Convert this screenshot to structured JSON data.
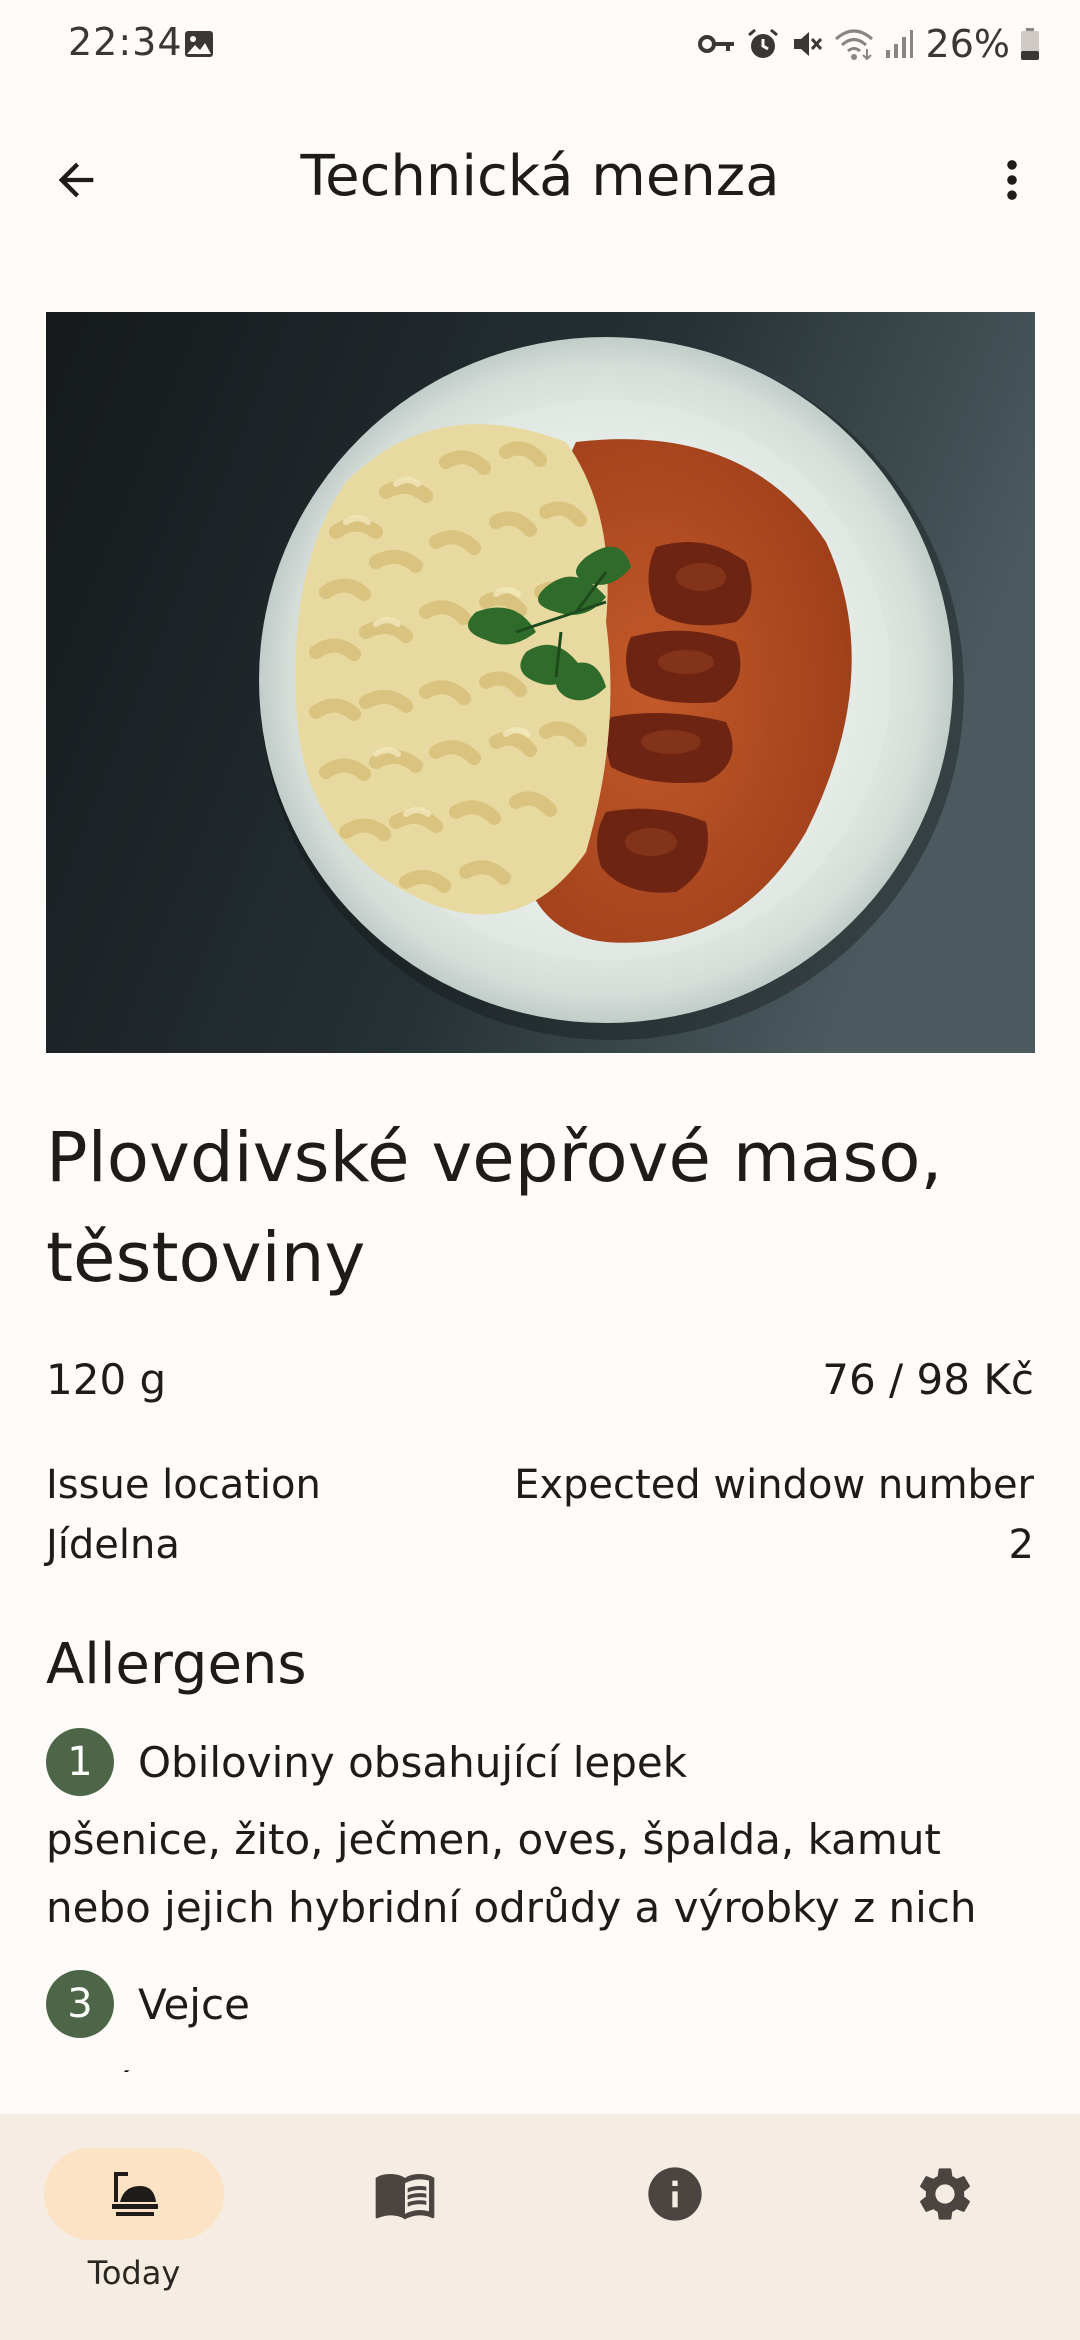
{
  "status_bar": {
    "time": "22:34",
    "battery": "26%",
    "icons": [
      "gallery-icon",
      "key-icon",
      "alarm-icon",
      "mute-icon",
      "wifi-icon",
      "signal-icon",
      "battery-icon"
    ]
  },
  "app_bar": {
    "title": "Technická menza",
    "icons": [
      "back-arrow-icon",
      "more-vert-icon"
    ]
  },
  "dish": {
    "name": "Plovdivské vepřové maso, těstoviny",
    "weight": "120 g",
    "price": "76 / 98 Kč",
    "issue_location_label": "Issue location",
    "issue_location_value": "Jídelna",
    "window_label": "Expected window number",
    "window_value": "2"
  },
  "allergens": {
    "heading": "Allergens",
    "items": [
      {
        "number": "1",
        "name": "Obiloviny obsahující lepek",
        "description": "pšenice, žito, ječmen, oves, špalda, kamut nebo jejich hybridní odrůdy a výrobky z nich"
      },
      {
        "number": "3",
        "name": "Vejce",
        "description": "a výrobky z nich"
      }
    ]
  },
  "bottom_nav": {
    "items": [
      {
        "label": "Today",
        "icon": "dining-table-icon",
        "active": true
      },
      {
        "label": "",
        "icon": "menu-book-icon",
        "active": false
      },
      {
        "label": "",
        "icon": "info-icon",
        "active": false
      },
      {
        "label": "",
        "icon": "settings-gear-icon",
        "active": false
      }
    ]
  },
  "colors": {
    "background": "#FFFBF8",
    "nav_background": "#F5EDE4",
    "active_pill": "#FCE3C5",
    "allergen_badge": "#4C6647",
    "text": "#1E1B18"
  }
}
